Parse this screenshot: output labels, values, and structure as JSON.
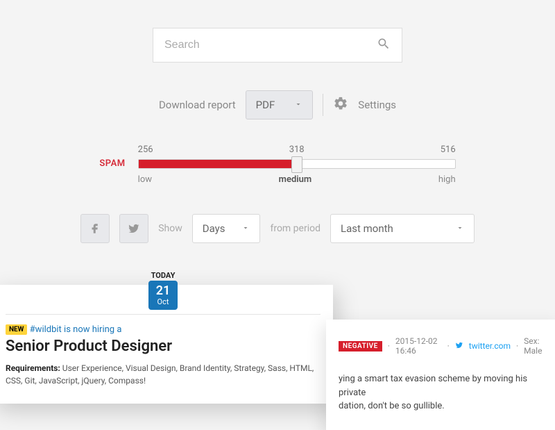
{
  "search": {
    "placeholder": "Search"
  },
  "toolbar": {
    "download_label": "Download report",
    "format_value": "PDF",
    "settings_label": "Settings"
  },
  "slider": {
    "title": "SPAM",
    "min_tick": "256",
    "mid_tick": "318",
    "max_tick": "516",
    "min_label": "low",
    "mid_label": "medium",
    "max_label": "high"
  },
  "filters": {
    "show_label": "Show",
    "unit_value": "Days",
    "period_label": "from period",
    "period_value": "Last month"
  },
  "card_left": {
    "today_label": "TODAY",
    "day": "21",
    "month": "Oct",
    "new_badge": "NEW",
    "hashtag": "#wildbit",
    "hiring_text": " is now hiring a",
    "job_title": "Senior Product Designer",
    "req_label": "Requirements:",
    "req_text": " User Experience, Visual Design, Brand Identity, Strategy, Sass, HTML, CSS, Git, JavaScript, jQuery, Compass!"
  },
  "card_right": {
    "neg_badge": "NEGATIVE",
    "timestamp": "2015-12-02 16:46",
    "source": "twitter.com",
    "sex": "Sex: Male",
    "snippet_a": "ying a smart tax evasion scheme by moving his private",
    "snippet_b": "dation, don't be so gullible."
  }
}
